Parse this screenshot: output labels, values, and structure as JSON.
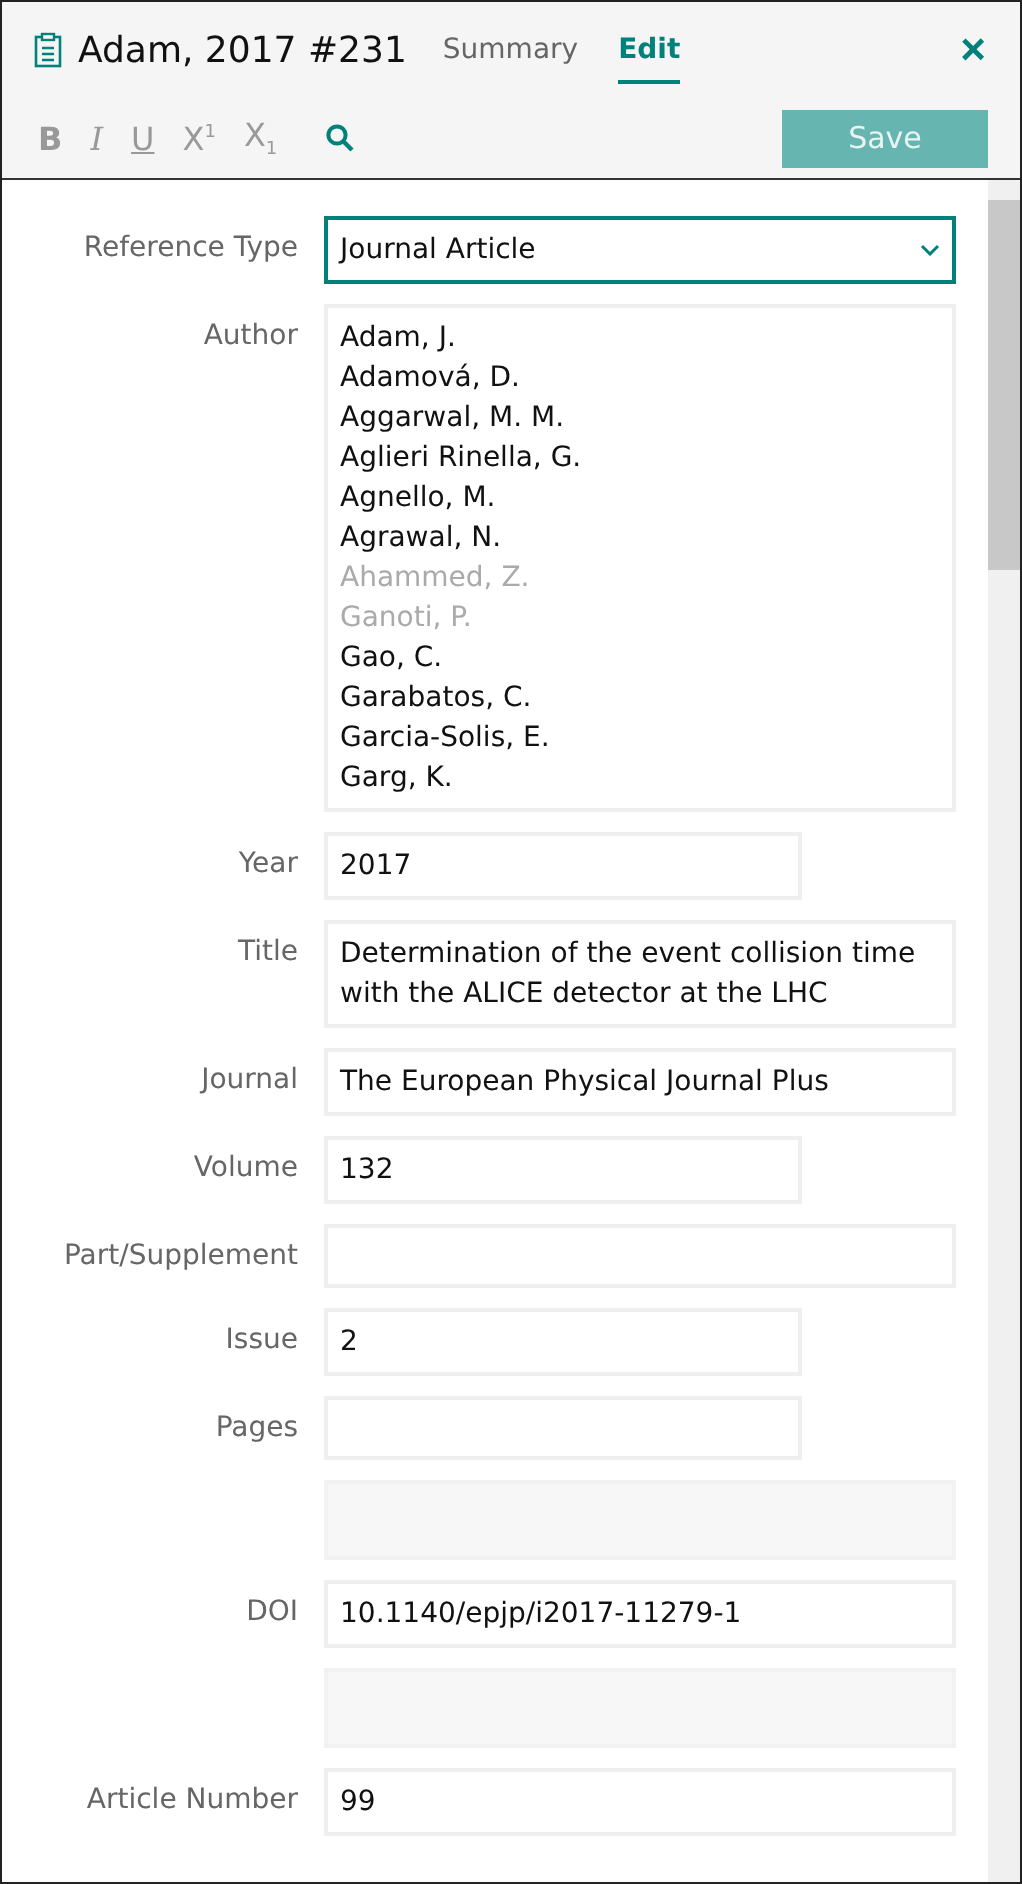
{
  "header": {
    "title": "Adam, 2017 #231",
    "tabs": [
      {
        "label": "Summary",
        "selected": false
      },
      {
        "label": "Edit",
        "selected": true
      }
    ],
    "close": "×"
  },
  "toolbar": {
    "format_buttons": [
      {
        "label": "B",
        "kind": "bold",
        "disabled": true
      },
      {
        "label": "I",
        "kind": "italic",
        "disabled": true
      },
      {
        "label": "U",
        "kind": "underline",
        "disabled": true
      },
      {
        "label": "X$^{1}$",
        "kind": "plain",
        "disabled": true
      },
      {
        "label": "X$_{1}$",
        "kind": "plain",
        "disabled": true
      }
    ],
    "save": {
      "label": "Save",
      "disabled": true
    }
  },
  "fields": [
    {
      "kind": "select",
      "label": "Reference Type",
      "value": "Journal Article"
    },
    {
      "kind": "list",
      "label": "Author",
      "items": [
        {
          "text": "Adam, J.",
          "faded": false
        },
        {
          "text": "Adamová, D.",
          "faded": false
        },
        {
          "text": "Aggarwal, M. M.",
          "faded": false
        },
        {
          "text": "Aglieri Rinella, G.",
          "faded": false
        },
        {
          "text": "Agnello, M.",
          "faded": false
        },
        {
          "text": "Agrawal, N.",
          "faded": false
        },
        {
          "text": "Ahammed, Z.",
          "faded": true
        },
        {
          "text": "Ganoti, P.",
          "faded": true
        },
        {
          "text": "Gao, C.",
          "faded": false
        },
        {
          "text": "Garabatos, C.",
          "faded": false
        },
        {
          "text": "Garcia-Solis, E.",
          "faded": false
        },
        {
          "text": "Garg, K.",
          "faded": false
        }
      ]
    },
    {
      "kind": "short",
      "label": "Year",
      "value": "2017"
    },
    {
      "kind": "wide",
      "label": "Title",
      "value": "Determination of the event collision time with the ALICE detector at the LHC"
    },
    {
      "kind": "wide",
      "label": "Journal",
      "value": "The European Physical Journal Plus"
    },
    {
      "kind": "short",
      "label": "Volume",
      "value": "132"
    },
    {
      "kind": "wide",
      "label": "Part/Supplement"
    },
    {
      "kind": "short",
      "label": "Issue",
      "value": "2"
    },
    {
      "kind": "short",
      "label": "Pages"
    },
    {
      "kind": "faded"
    },
    {
      "kind": "wide",
      "label": "DOI",
      "value": "10.1140/epjp/i2017-11279-1"
    },
    {
      "kind": "faded"
    },
    {
      "kind": "wide",
      "label": "Article Number",
      "value": "99"
    }
  ]
}
